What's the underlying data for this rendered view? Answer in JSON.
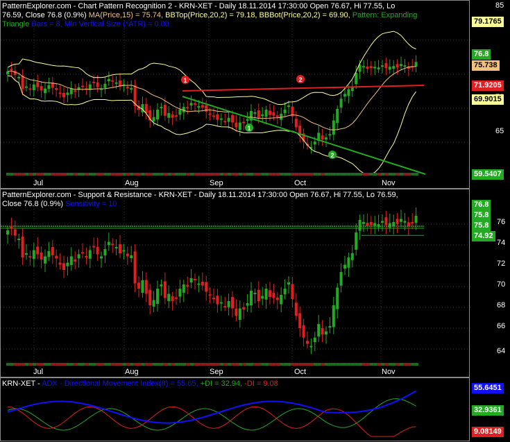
{
  "pane1": {
    "header_line1": "PatternExplorer.com - Chart Pattern Recognition 2 - KRN-XET - Daily 18.11.2014 17:30:00 Open 76.67, Hi 77.55, Lo",
    "header_line2_a": "76.59, Close 76.8 (0.9%) ",
    "header_ma": "MA(Price,15) = 75.74, ",
    "header_bbtop": "BBTop(Price,20,2) = 79.18, ",
    "header_bbbot": "BBBot(Price,20,2) = 69.90, ",
    "header_pattern": "Pattern: Expanding",
    "header_line3": "Triangle",
    "header_line3b": "Bars = 8, Min Vertical Size (*ATR) = 0.00",
    "y_ticks": [
      "85",
      "80",
      "75",
      "70",
      "65",
      "60"
    ],
    "tags": [
      {
        "text": "79.1765",
        "bg": "#ffff99",
        "fg": "#000000"
      },
      {
        "text": "76.8",
        "bg": "#22aa22",
        "fg": "#ffffff"
      },
      {
        "text": "75.738",
        "bg": "#f4c07a",
        "fg": "#000000"
      },
      {
        "text": "71.9205",
        "bg": "#e02020",
        "fg": "#ffffff"
      },
      {
        "text": "69.9015",
        "bg": "#ffff99",
        "fg": "#000000"
      },
      {
        "text": "59.5407",
        "bg": "#22aa22",
        "fg": "#ffffff"
      }
    ],
    "markers": [
      "1",
      "2",
      "1",
      "2"
    ]
  },
  "pane2": {
    "header_line1": "PatternExplorer.com - Support & Resistance - KRN-XET - Daily 18.11.2014 17:30:00 Open 76.67, Hi 77.55, Lo 76.59,",
    "header_line2": "Close 76.8 (0.9%) ",
    "header_sens": "Sensitivity = 10",
    "y_ticks": [
      "76",
      "74",
      "72",
      "70",
      "68",
      "66",
      "64"
    ],
    "tags": [
      {
        "text": "76.8",
        "bg": "#22aa22",
        "fg": "#ffffff"
      },
      {
        "text": "75.8",
        "bg": "#22aa22",
        "fg": "#ffffff"
      },
      {
        "text": "75.8",
        "bg": "#22aa22",
        "fg": "#ffffff"
      },
      {
        "text": "74.92",
        "bg": "#22aa22",
        "fg": "#ffffff"
      }
    ]
  },
  "pane3": {
    "header_sym": "KRN-XET - ",
    "header_adx": "ADX - Directional Movement Index(8) = 55.65, ",
    "header_pdi": "+DI = 32.94, ",
    "header_mdi": "-DI = 9.08",
    "tags": [
      {
        "text": "55.6451",
        "bg": "#1010ff",
        "fg": "#ffffff"
      },
      {
        "text": "32.9361",
        "bg": "#22aa22",
        "fg": "#ffffff"
      },
      {
        "text": "9.08149",
        "bg": "#e02020",
        "fg": "#ffffff"
      }
    ]
  },
  "x_labels": [
    "Jul",
    "Aug",
    "Sep",
    "Oct",
    "Nov"
  ],
  "colors": {
    "up": "#22aa22",
    "down": "#e02020",
    "bbands": "#ffff99",
    "ma": "#f4c07a",
    "adx": "#1010ff",
    "support": "#22aa22",
    "resistance": "#e02020"
  },
  "chart_data": {
    "type": "candlestick",
    "closes": [
      75.4,
      75.6,
      74.9,
      74.6,
      72.8,
      73.2,
      72.9,
      73.5,
      73.1,
      72.6,
      72.9,
      73.4,
      73.0,
      72.7,
      72.1,
      71.6,
      72.3,
      72.9,
      72.4,
      73.1,
      73.3,
      72.8,
      73.5,
      73.8,
      73.1,
      72.9,
      73.6,
      74.3,
      74.1,
      73.8,
      73.2,
      73.5,
      72.9,
      73.0,
      70.3,
      69.8,
      70.6,
      69.3,
      68.2,
      68.7,
      69.8,
      70.2,
      68.9,
      69.3,
      68.6,
      68.9,
      69.8,
      70.2,
      70.0,
      70.8,
      70.6,
      70.3,
      70.1,
      69.5,
      69.2,
      68.8,
      68.3,
      68.5,
      68.1,
      68.6,
      67.9,
      67.2,
      67.9,
      67.8,
      68.4,
      69.6,
      69.4,
      68.6,
      69.1,
      69.8,
      69.0,
      68.9,
      68.7,
      69.2,
      69.8,
      70.4,
      68.8,
      67.2,
      66.0,
      65.1,
      64.5,
      64.3,
      65.1,
      66.4,
      65.4,
      65.7,
      66.2,
      68.2,
      69.9,
      71.4,
      72.1,
      72.8,
      73.2,
      75.2,
      76.4,
      76.2,
      75.8,
      75.9,
      76.1,
      76.0,
      76.3,
      75.9,
      76.1,
      76.2,
      76.0,
      76.5,
      76.3,
      75.8,
      76.1,
      76.8
    ]
  }
}
